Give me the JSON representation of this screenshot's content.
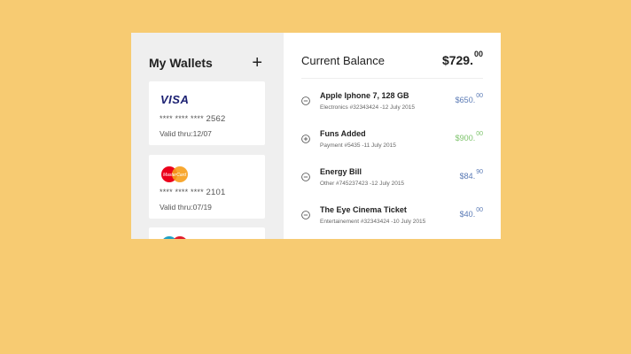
{
  "wallets": {
    "title": "My Wallets",
    "add_label": "+",
    "cards": [
      {
        "brand": "VISA",
        "number_mask": "**** **** ****",
        "last4": "2562",
        "valid": "Valid thru:12/07"
      },
      {
        "brand": "MasterCard",
        "number_mask": "**** **** ****",
        "last4": "2101",
        "valid": "Valid thru:07/19"
      }
    ]
  },
  "balance": {
    "title": "Current Balance",
    "amount": "$729.",
    "cents": "00"
  },
  "transactions": [
    {
      "title": "Apple Iphone 7, 128 GB",
      "subtitle": "Electronics #32343424 -12 July 2015",
      "amount": "$650.",
      "cents": "00",
      "type": "debit"
    },
    {
      "title": "Funs Added",
      "subtitle": "Payment #5435 -11 July 2015",
      "amount": "$900.",
      "cents": "00",
      "type": "credit"
    },
    {
      "title": "Energy Bill",
      "subtitle": "Other #745237423 -12 July 2015",
      "amount": "$84.",
      "cents": "90",
      "type": "debit"
    },
    {
      "title": "The Eye Cinema Ticket",
      "subtitle": "Entertainement #32343424 -10 July 2015",
      "amount": "$40.",
      "cents": "00",
      "type": "debit"
    }
  ],
  "colors": {
    "background": "#f7cb72",
    "debit": "#5a7ab5",
    "credit": "#7cc36a"
  }
}
